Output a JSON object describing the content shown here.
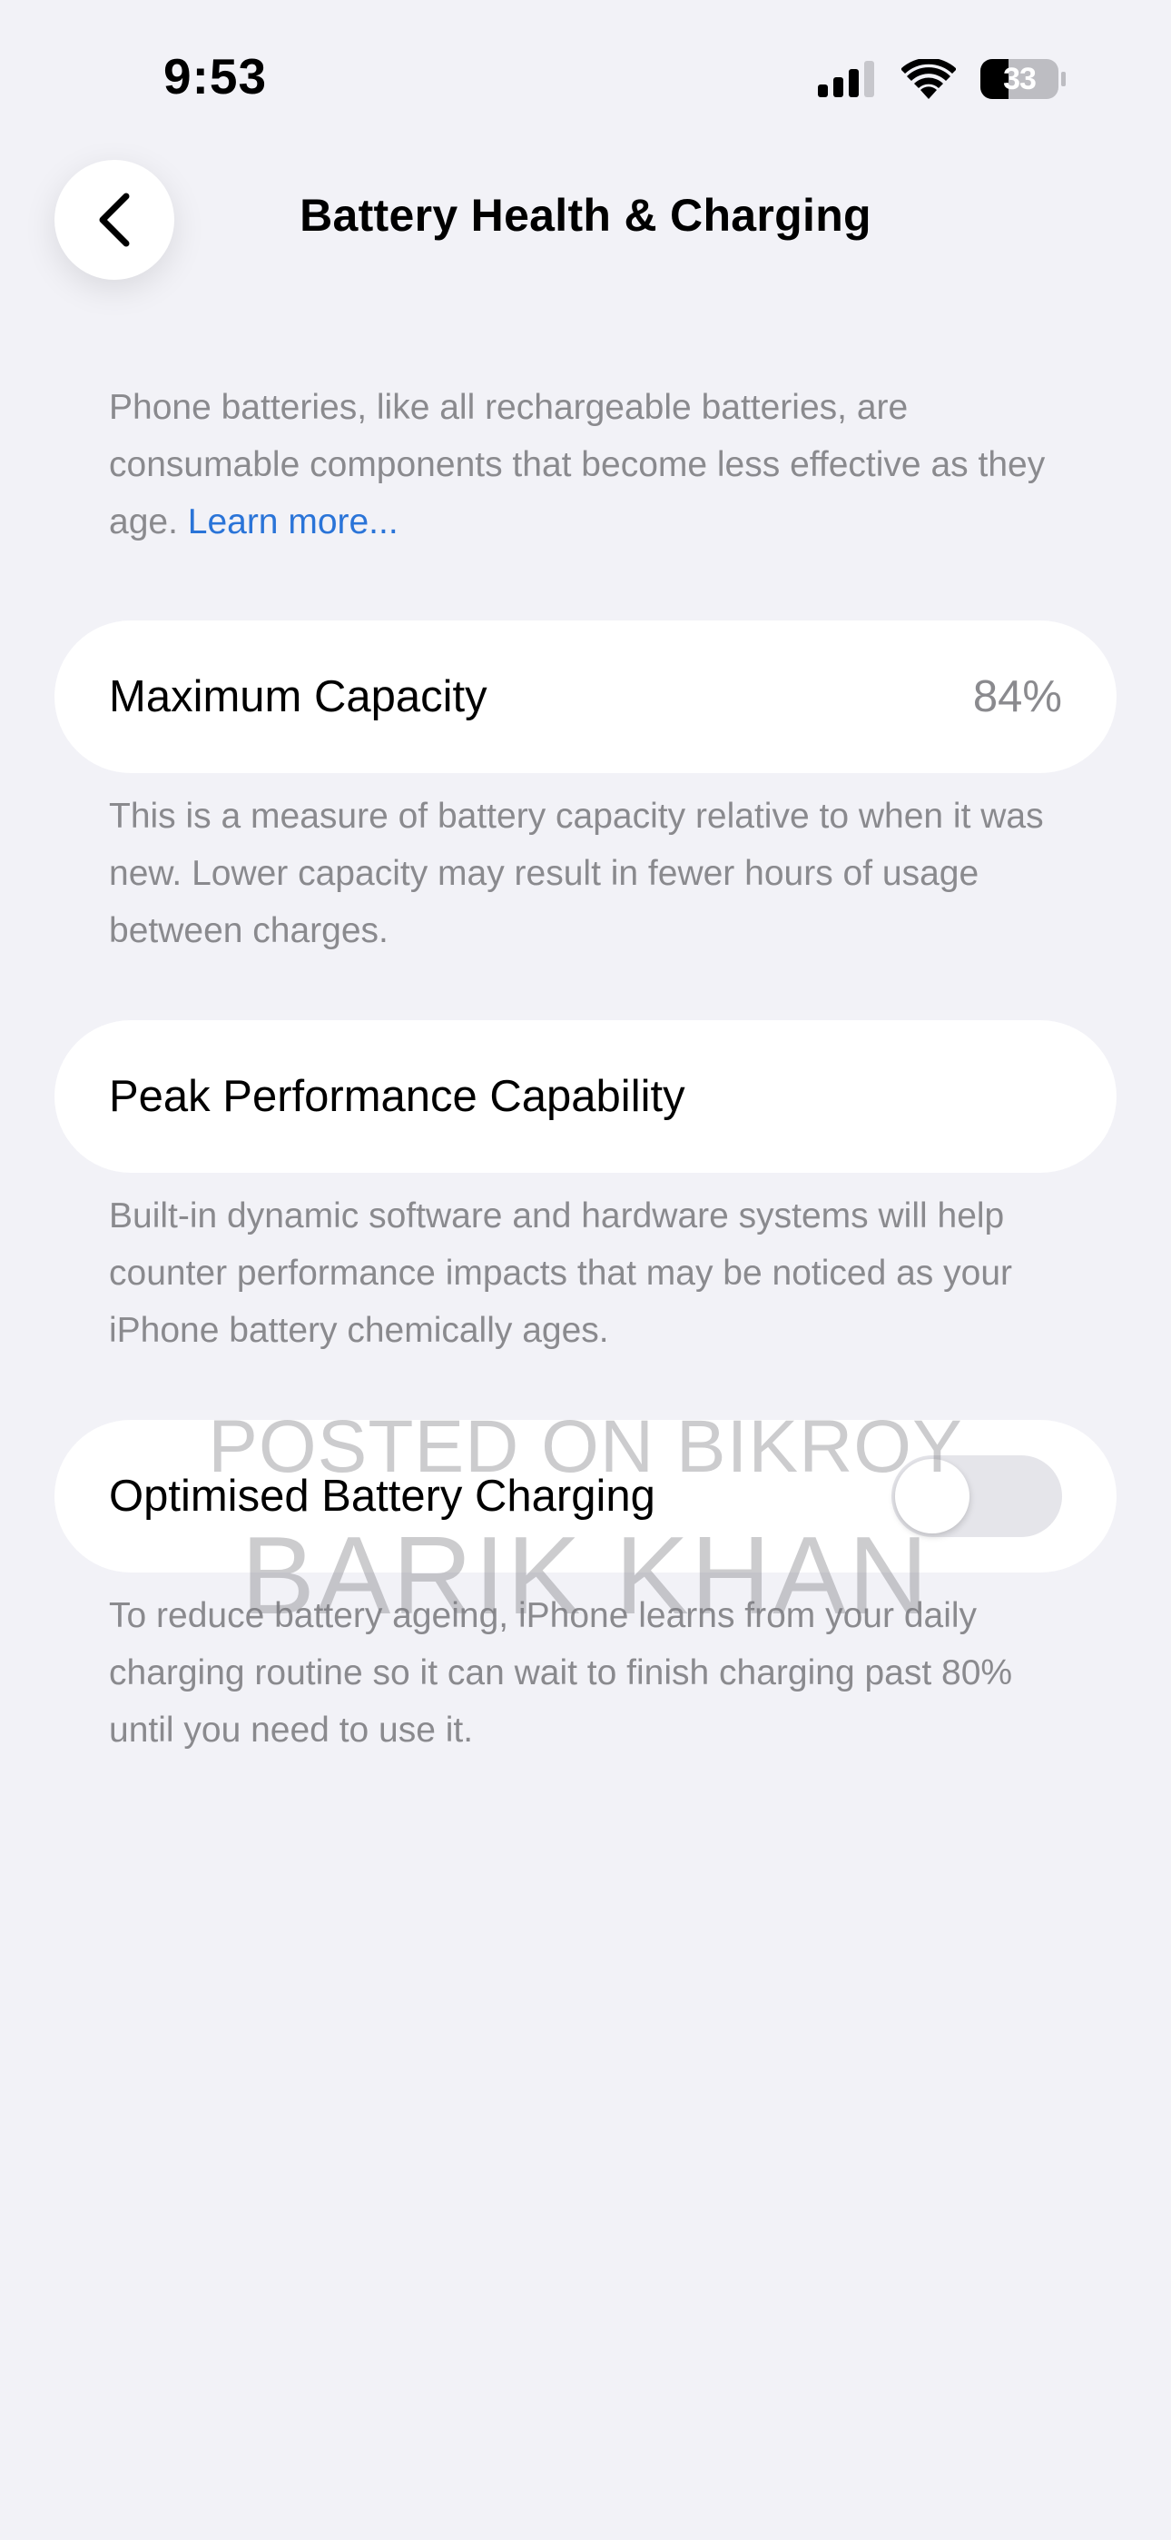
{
  "status_bar": {
    "time": "9:53",
    "battery_level": "33",
    "signal_icon": "cellular-signal-icon",
    "wifi_icon": "wifi-icon",
    "battery_icon": "battery-icon"
  },
  "nav": {
    "back_icon": "chevron-left-icon",
    "title": "Battery Health & Charging"
  },
  "intro": {
    "text": "Phone batteries, like all rechargeable batteries, are consumable components that become less effective as they age.",
    "link_label": "Learn more..."
  },
  "maximum_capacity": {
    "label": "Maximum Capacity",
    "value": "84%",
    "footnote": "This is a measure of battery capacity relative to when it was new. Lower capacity may result in fewer hours of usage between charges."
  },
  "peak_performance": {
    "label": "Peak Performance Capability",
    "footnote": "Built-in dynamic software and hardware systems will help counter performance impacts that may be noticed as your iPhone battery chemically ages."
  },
  "optimised_charging": {
    "label": "Optimised Battery Charging",
    "toggle_on": false,
    "footnote": "To reduce battery ageing, iPhone learns from your daily charging routine so it can wait to finish charging past 80% until you need to use it."
  },
  "watermark": {
    "line1": "POSTED ON BIKROY",
    "line2": "BARIK KHAN"
  },
  "colors": {
    "background": "#f2f2f7",
    "card": "#ffffff",
    "secondary_text": "#8a8a8e",
    "link": "#2a74d8",
    "toggle_off": "#e5e5ea"
  }
}
